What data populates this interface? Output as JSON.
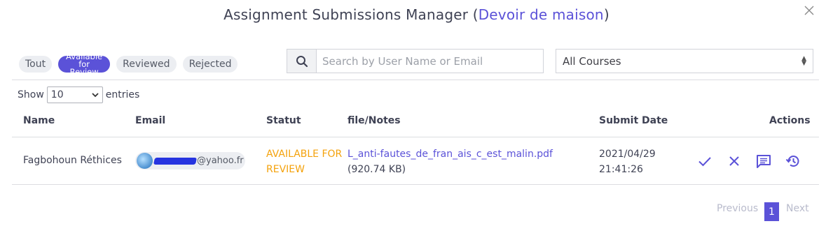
{
  "modal": {
    "title_prefix": "Assignment Submissions Manager (",
    "title_accent": "Devoir de maison",
    "title_suffix": ")"
  },
  "tabs": [
    {
      "label": "Tout"
    },
    {
      "label": "Available for Review",
      "active": true
    },
    {
      "label": "Reviewed"
    },
    {
      "label": "Rejected"
    }
  ],
  "search": {
    "placeholder": "Search by User Name or Email",
    "value": ""
  },
  "course_filter": {
    "selected": "All Courses"
  },
  "length": {
    "show_label": "Show",
    "value": "10",
    "entries_label": "entries"
  },
  "table": {
    "headers": [
      "Name",
      "Email",
      "Statut",
      "file/Notes",
      "Submit Date",
      "Actions"
    ],
    "rows": [
      {
        "name": "Fagbohoun Réthices",
        "email_domain": "@yahoo.fr",
        "status_line1": "AVAILABLE FOR",
        "status_line2": "REVIEW",
        "file_name": "L_anti-fautes_de_fran_ais_c_est_malin.pdf",
        "file_size": "(920.74 KB)",
        "date": "2021/04/29",
        "time": "21:41:26"
      }
    ]
  },
  "pagination": {
    "previous": "Previous",
    "current": "1",
    "next": "Next"
  },
  "colors": {
    "accent": "#5b52d8",
    "status_pending": "#f4a20c"
  },
  "icons": [
    "close-icon",
    "search-icon",
    "chevron-down-icon",
    "check-icon",
    "x-icon",
    "comment-icon",
    "history-icon"
  ]
}
